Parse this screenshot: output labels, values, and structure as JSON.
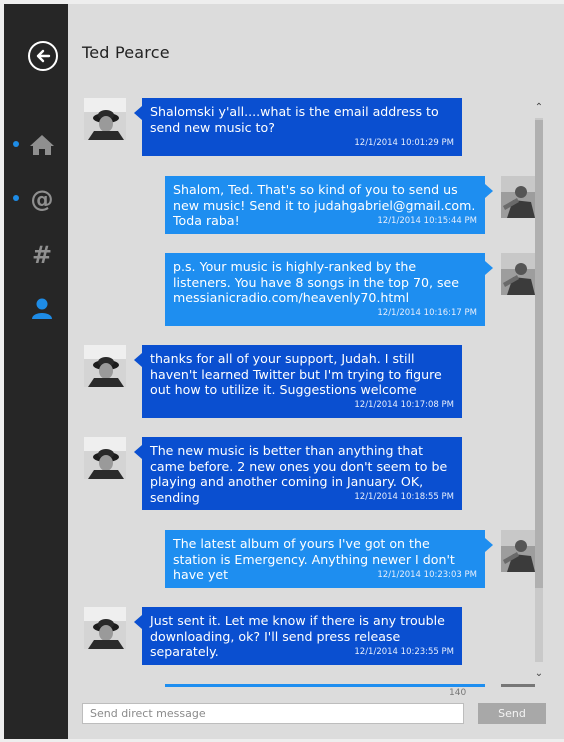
{
  "header": {
    "title": "Ted Pearce"
  },
  "nav": [
    {
      "name": "home",
      "icon": "home-icon",
      "unread": true
    },
    {
      "name": "mentions",
      "icon": "at-icon",
      "unread": true
    },
    {
      "name": "hashtags",
      "icon": "hash-icon",
      "unread": false
    },
    {
      "name": "profile",
      "icon": "user-icon",
      "unread": false,
      "active": true
    }
  ],
  "messages": [
    {
      "dir": "in",
      "text": "Shalomski y'all....what is the email address to send new music to?",
      "time": "12/1/2014 10:01:29 PM"
    },
    {
      "dir": "out",
      "text": "Shalom, Ted. That's so kind of you to send us new music! Send it to judahgabriel@gmail.com. Toda raba!",
      "time": "12/1/2014 10:15:44 PM"
    },
    {
      "dir": "out",
      "text": "p.s. Your music is highly-ranked by the listeners. You have 8 songs in the top 70, see messianicradio.com/heavenly70.html",
      "time": "12/1/2014 10:16:17 PM"
    },
    {
      "dir": "in",
      "text": "thanks for all of your support, Judah. I still haven't learned Twitter but I'm trying to figure out how to utilize it. Suggestions welcome",
      "time": "12/1/2014 10:17:08 PM"
    },
    {
      "dir": "in",
      "text": "The new music is better than anything that came before. 2 new ones you don't seem to be playing and another coming in January. OK, sending",
      "time": "12/1/2014 10:18:55 PM"
    },
    {
      "dir": "out",
      "text": "The latest album of yours I've got on the station is Emergency. Anything newer I don't have yet",
      "time": "12/1/2014 10:23:03 PM"
    },
    {
      "dir": "in",
      "text": "Just sent it. Let me know if there is any trouble downloading, ok? I'll send press release separately.",
      "time": "12/1/2014 10:23:55 PM"
    }
  ],
  "composer": {
    "placeholder": "Send direct message",
    "char_count": "140",
    "send_label": "Send"
  },
  "colors": {
    "sidebar": "#262626",
    "incoming": "#0a4fd0",
    "outgoing": "#1e8ef0",
    "accent": "#1e8ce6"
  }
}
